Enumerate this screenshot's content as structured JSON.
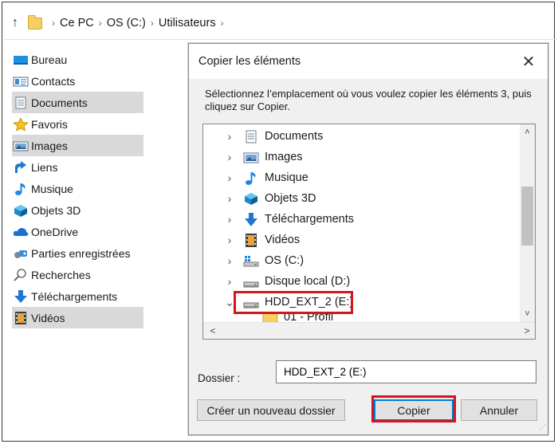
{
  "breadcrumb": {
    "items": [
      "Ce PC",
      "OS (C:)",
      "Utilisateurs"
    ],
    "separator": "›",
    "up_glyph": "↑"
  },
  "sidebar": {
    "items": [
      {
        "label": "Bureau",
        "icon": "desktop-icon",
        "selected": false
      },
      {
        "label": "Contacts",
        "icon": "contacts-icon",
        "selected": false
      },
      {
        "label": "Documents",
        "icon": "documents-icon",
        "selected": true
      },
      {
        "label": "Favoris",
        "icon": "star-icon",
        "selected": false
      },
      {
        "label": "Images",
        "icon": "images-icon",
        "selected": true
      },
      {
        "label": "Liens",
        "icon": "link-icon",
        "selected": false
      },
      {
        "label": "Musique",
        "icon": "music-icon",
        "selected": false
      },
      {
        "label": "Objets 3D",
        "icon": "cube-icon",
        "selected": false
      },
      {
        "label": "OneDrive",
        "icon": "cloud-icon",
        "selected": false
      },
      {
        "label": "Parties enregistrées",
        "icon": "saved-games-icon",
        "selected": false
      },
      {
        "label": "Recherches",
        "icon": "search-icon",
        "selected": false
      },
      {
        "label": "Téléchargements",
        "icon": "download-icon",
        "selected": false
      },
      {
        "label": "Vidéos",
        "icon": "video-icon",
        "selected": true
      }
    ]
  },
  "dialog": {
    "title": "Copier les éléments",
    "close_glyph": "✕",
    "instruction": "Sélectionnez l’emplacement où vous voulez copier les éléments 3, puis cliquez sur Copier.",
    "tree": [
      {
        "label": "Documents",
        "icon": "documents-icon",
        "chevron": "›"
      },
      {
        "label": "Images",
        "icon": "images-icon",
        "chevron": "›"
      },
      {
        "label": "Musique",
        "icon": "music-icon",
        "chevron": "›"
      },
      {
        "label": "Objets 3D",
        "icon": "cube-icon",
        "chevron": "›"
      },
      {
        "label": "Téléchargements",
        "icon": "download-icon",
        "chevron": "›"
      },
      {
        "label": "Vidéos",
        "icon": "video-icon",
        "chevron": "›"
      },
      {
        "label": "OS (C:)",
        "icon": "os-drive-icon",
        "chevron": "›"
      },
      {
        "label": "Disque local (D:)",
        "icon": "drive-icon",
        "chevron": "›"
      },
      {
        "label": "HDD_EXT_2 (E:)",
        "icon": "drive-icon",
        "chevron": "⌄"
      },
      {
        "label": "01 - Profil",
        "icon": "folder-icon",
        "chevron": ""
      }
    ],
    "folder_label": "Dossier :",
    "folder_value": "HDD_EXT_2 (E:)",
    "new_folder_button": "Créer un nouveau dossier",
    "copy_button": "Copier",
    "cancel_button": "Annuler",
    "scroll_up": "˄",
    "scroll_down": "˅",
    "scroll_left": "<",
    "scroll_right": ">",
    "grip": "⋰"
  },
  "colors": {
    "highlight": "#d6141c",
    "selection": "#d9d9d9",
    "accent": "#0078d7"
  }
}
